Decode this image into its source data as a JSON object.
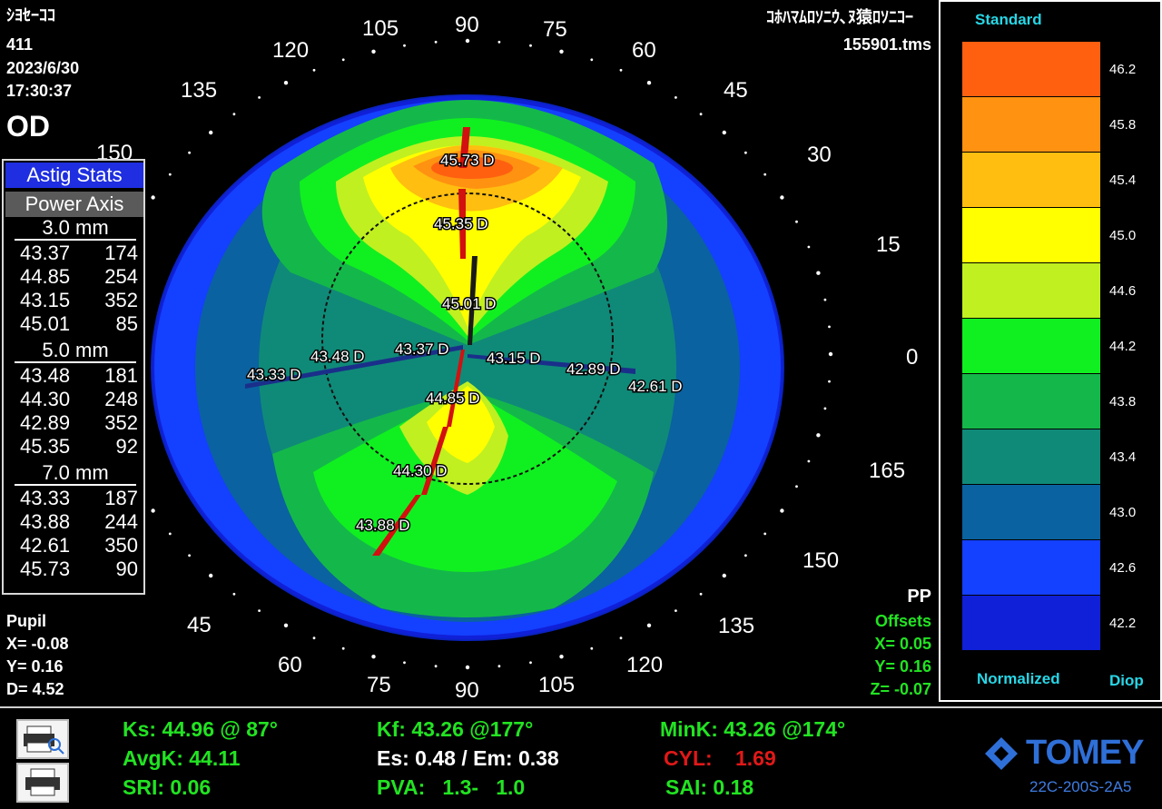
{
  "header": {
    "patient_name": "ｼﾖｾｰｺｺ",
    "id": "411",
    "date": "2023/6/30",
    "time": "17:30:37",
    "eye": "OD",
    "title_right": "ｺﾎﾊﾏﾑﾛｿﾆｳ､ﾇ猿ﾛｿﾆｺｰ",
    "filename": "155901.tms"
  },
  "axis_labels": {
    "a120": "120",
    "a105": "105",
    "a90": "90",
    "a75": "75",
    "a60": "60",
    "a45": "45",
    "a30": "30",
    "a15": "15",
    "a0": "0",
    "a165": "165",
    "a150": "150",
    "a135": "135",
    "b150": "150",
    "b135": "135",
    "c45": "45",
    "c60": "60",
    "c75": "75",
    "c90": "90",
    "c105": "105",
    "c120": "120",
    "c135": "135",
    "c150": "150",
    "c165": "165"
  },
  "stats": {
    "button1": "Astig Stats",
    "button2": "Power Axis",
    "groups": [
      {
        "label": "3.0 mm",
        "rows": [
          {
            "k": "43.37",
            "a": "174"
          },
          {
            "k": "44.85",
            "a": "254"
          },
          {
            "k": "43.15",
            "a": "352"
          },
          {
            "k": "45.01",
            "a": "85"
          }
        ]
      },
      {
        "label": "5.0 mm",
        "rows": [
          {
            "k": "43.48",
            "a": "181"
          },
          {
            "k": "44.30",
            "a": "248"
          },
          {
            "k": "42.89",
            "a": "352"
          },
          {
            "k": "45.35",
            "a": "92"
          }
        ]
      },
      {
        "label": "7.0 mm",
        "rows": [
          {
            "k": "43.33",
            "a": "187"
          },
          {
            "k": "43.88",
            "a": "244"
          },
          {
            "k": "42.61",
            "a": "350"
          },
          {
            "k": "45.73",
            "a": "90"
          }
        ]
      }
    ]
  },
  "map_labels": {
    "l1": "45.73 D",
    "l2": "45.35 D",
    "l3": "45.01 D",
    "l4": "43.48 D",
    "l5": "43.37 D",
    "l6": "43.15 D",
    "l7": "42.89 D",
    "l8": "43.33 D",
    "l9": "42.61 D",
    "l10": "44.85 D",
    "l11": "44.30 D",
    "l12": "43.88 D"
  },
  "pupil": {
    "title": "Pupil",
    "x": "X= -0.08",
    "y": "Y=  0.16",
    "d": "D=  4.52"
  },
  "offsets": {
    "pp": "PP",
    "title": "Offsets",
    "x": "X=  0.05",
    "y": "Y=  0.16",
    "z": "Z= -0.07"
  },
  "legend": {
    "top_label": "Standard",
    "bottom_left": "Normalized",
    "bottom_right": "Diop",
    "colors": [
      "#ff6010",
      "#ff9210",
      "#ffbe10",
      "#ffff00",
      "#c0f020",
      "#10f020",
      "#14b84a",
      "#0f8a78",
      "#0a62a0",
      "#1440ff",
      "#1020d8"
    ],
    "values": [
      "46.2",
      "45.8",
      "45.4",
      "45.0",
      "44.6",
      "44.2",
      "43.8",
      "43.4",
      "43.0",
      "42.6",
      "42.2"
    ]
  },
  "indices": {
    "ks": "Ks: 44.96 @ 87°",
    "kf": "Kf: 43.26 @177°",
    "mink": "MinK: 43.26 @174°",
    "avgk": "AvgK: 44.11",
    "es": "Es: 0.48 / Em: 0.38",
    "cyl_label": "CYL:",
    "cyl_value": "1.69",
    "sri": "SRI: 0.06",
    "pva": "PVA:   1.3-   1.0",
    "sai": "SAI: 0.18"
  },
  "brand": {
    "logo": "TOMEY",
    "model": "22C-200S-2A5"
  },
  "icons": {
    "print_preview": "print-preview-icon",
    "print": "printer-icon"
  }
}
